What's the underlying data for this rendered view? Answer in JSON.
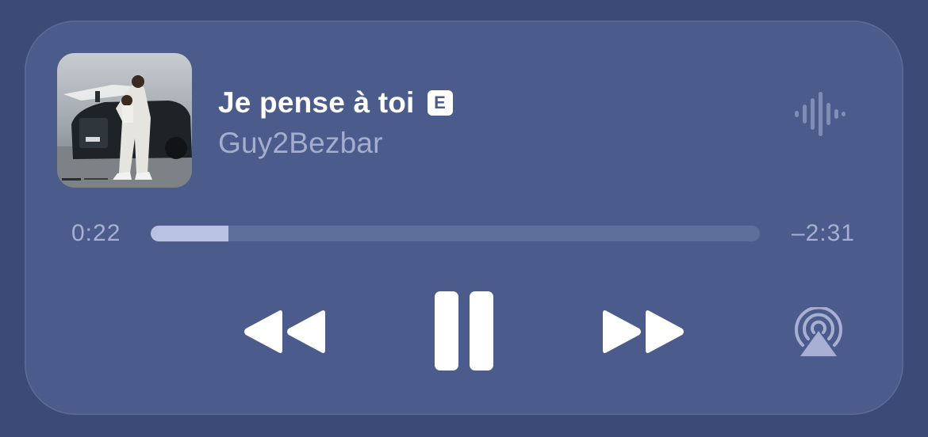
{
  "now_playing": {
    "title": "Je pense à toi",
    "explicit_badge": "E",
    "artist": "Guy2Bezbar",
    "artwork": "album-cover-car-jet-photo"
  },
  "playback": {
    "elapsed": "0:22",
    "remaining": "–2:31",
    "progress_fraction": 0.127
  },
  "controls": {
    "rewind": "rewind-icon",
    "pause": "pause-icon",
    "forward": "fast-forward-icon",
    "airplay": "airplay-icon",
    "waveform": "waveform-icon"
  },
  "colors": {
    "background": "#3b4a77",
    "card": "#4b5b8b",
    "primary_text": "#ffffff",
    "secondary_text": "#a3add0",
    "track": "#5f6f9c",
    "track_fill": "#b9c2e0"
  }
}
